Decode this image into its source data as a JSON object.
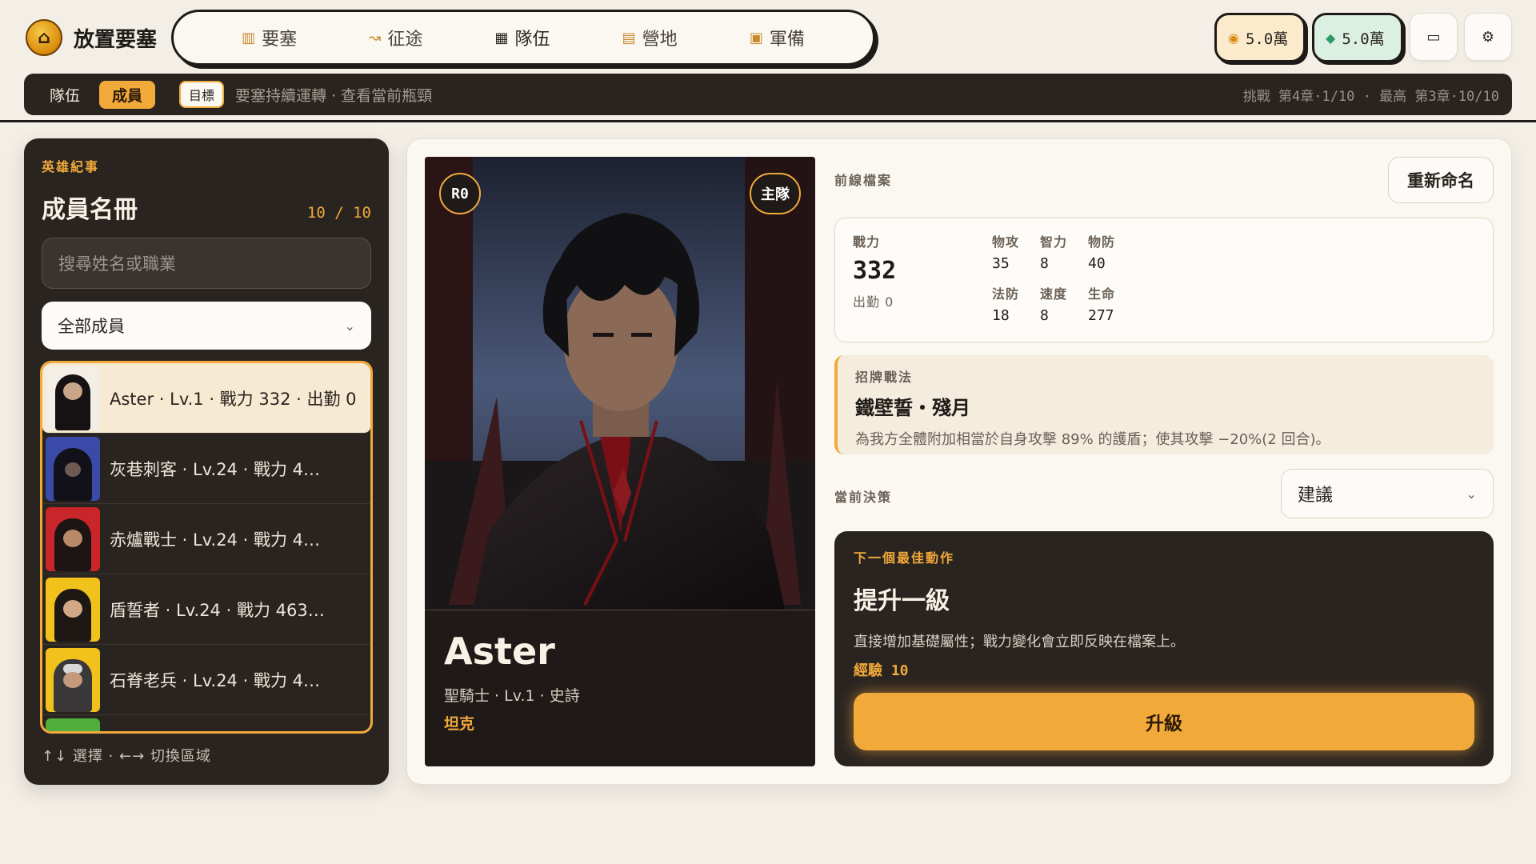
{
  "app": {
    "title": "放置要塞"
  },
  "nav": [
    {
      "label": "要塞",
      "icon": "fortress-icon"
    },
    {
      "label": "征途",
      "icon": "route-icon"
    },
    {
      "label": "隊伍",
      "icon": "grid-icon"
    },
    {
      "label": "營地",
      "icon": "camp-icon"
    },
    {
      "label": "軍備",
      "icon": "armory-icon"
    }
  ],
  "resources": {
    "gold": "5.0萬",
    "gem": "5.0萬"
  },
  "subbar": {
    "tabs": [
      "隊伍",
      "成員"
    ],
    "goal_tag": "目標",
    "goal_text": "要塞持續運轉 · 查看當前瓶頸",
    "progress": "挑戰 第4章·1/10 · 最高 第3章·10/10"
  },
  "roster": {
    "kicker": "英雄紀事",
    "title": "成員名冊",
    "count": "10 / 10",
    "search_placeholder": "搜尋姓名或職業",
    "filter": "全部成員",
    "members": [
      {
        "text": "Aster · Lv.1 · 戰力 332 · 出勤 0"
      },
      {
        "text": "灰巷刺客 · Lv.24 · 戰力 4…"
      },
      {
        "text": "赤爐戰士 · Lv.24 · 戰力 4…"
      },
      {
        "text": "盾誓者 · Lv.24 · 戰力 463…"
      },
      {
        "text": "石脊老兵 · Lv.24 · 戰力 4…"
      }
    ],
    "footer": "↑↓ 選擇 · ←→ 切換區域"
  },
  "hero": {
    "rank": "R0",
    "team": "主隊",
    "name": "Aster",
    "meta": "聖騎士 · Lv.1 · 史詩",
    "role": "坦克"
  },
  "detail": {
    "section_label": "前線檔案",
    "rename": "重新命名",
    "power_label": "戰力",
    "power": "332",
    "deploy": "出勤 0",
    "stats": [
      {
        "label": "物攻",
        "value": "35"
      },
      {
        "label": "智力",
        "value": "8"
      },
      {
        "label": "物防",
        "value": "40"
      },
      {
        "label": "法防",
        "value": "18"
      },
      {
        "label": "速度",
        "value": "8"
      },
      {
        "label": "生命",
        "value": "277"
      }
    ],
    "skill_label": "招牌戰法",
    "skill_name": "鐵壁誓・殘月",
    "skill_desc": "為我方全體附加相當於自身攻擊 89% 的護盾；使其攻擊 −20%(2 回合)。",
    "decision_label": "當前決策",
    "decision_value": "建議",
    "action_kicker": "下一個最佳動作",
    "action_title": "提升一級",
    "action_desc": "直接增加基礎屬性；戰力變化會立即反映在檔案上。",
    "action_xp": "經驗 10",
    "action_button": "升級"
  },
  "colors": {
    "accent": "#f1a93a",
    "dark": "#2a2421",
    "paper": "#fbf8f2"
  }
}
